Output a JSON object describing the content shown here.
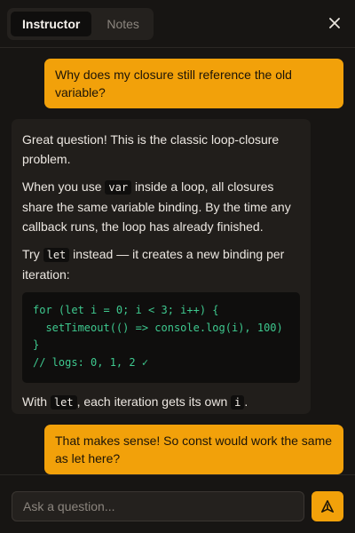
{
  "header": {
    "tabs": [
      {
        "label": "Instructor",
        "active": true
      },
      {
        "label": "Notes",
        "active": false
      }
    ],
    "close_icon": "close-icon"
  },
  "messages": {
    "user1": "Why does my closure still reference the old variable?",
    "assistant": {
      "p1": "Great question! This is the classic loop-closure problem.",
      "p2_a": "When you use ",
      "p2_code": "var",
      "p2_b": " inside a loop, all closures share the same variable binding. By the time any callback runs, the loop has already finished.",
      "p3_a": "Try ",
      "p3_code": "let",
      "p3_b": " instead — it creates a new binding per iteration:",
      "code": "for (let i = 0; i < 3; i++) {\n  setTimeout(() => console.log(i), 100)\n}\n// logs: 0, 1, 2 ✓",
      "p4_a": "With ",
      "p4_code": "let",
      "p4_b": ", each iteration gets its own ",
      "p4_code2": "i",
      "p4_c": "."
    },
    "user2": "That makes sense! So const would work the same as let here?"
  },
  "composer": {
    "placeholder": "Ask a question...",
    "send_icon": "send-icon"
  },
  "colors": {
    "accent": "#f2a10a",
    "background": "#171513",
    "bubble": "#211e1b",
    "code_text": "#3ec98f"
  }
}
